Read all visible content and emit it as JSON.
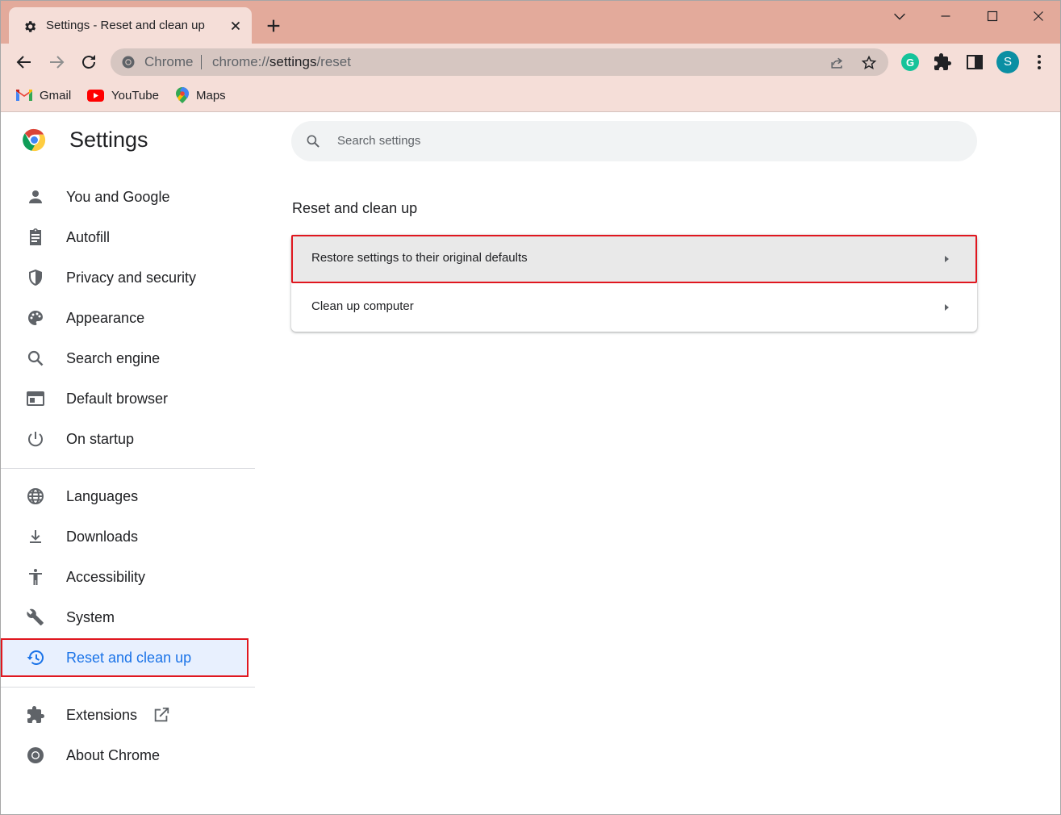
{
  "browser": {
    "tab_title": "Settings - Reset and clean up",
    "omnibox_site_label": "Chrome",
    "url_prefix": "chrome://",
    "url_host": "settings",
    "url_path": "/reset",
    "profile_initial": "S",
    "accent_colors": {
      "tabstrip": "#e3aa9b",
      "toolbar": "#f5ded8",
      "profile_avatar": "#0b8fa3",
      "highlight_border": "#e0171f",
      "active_blue": "#1a73e8"
    }
  },
  "bookmarks": [
    {
      "label": "Gmail",
      "icon": "gmail-icon"
    },
    {
      "label": "YouTube",
      "icon": "youtube-icon"
    },
    {
      "label": "Maps",
      "icon": "maps-icon"
    }
  ],
  "settings": {
    "title": "Settings",
    "search_placeholder": "Search settings",
    "nav_group_1": [
      {
        "label": "You and Google",
        "icon": "person-icon"
      },
      {
        "label": "Autofill",
        "icon": "clipboard-icon"
      },
      {
        "label": "Privacy and security",
        "icon": "shield-icon"
      },
      {
        "label": "Appearance",
        "icon": "palette-icon"
      },
      {
        "label": "Search engine",
        "icon": "search-icon"
      },
      {
        "label": "Default browser",
        "icon": "browser-icon"
      },
      {
        "label": "On startup",
        "icon": "power-icon"
      }
    ],
    "nav_group_2": [
      {
        "label": "Languages",
        "icon": "globe-icon"
      },
      {
        "label": "Downloads",
        "icon": "download-icon"
      },
      {
        "label": "Accessibility",
        "icon": "accessibility-icon"
      },
      {
        "label": "System",
        "icon": "wrench-icon"
      },
      {
        "label": "Reset and clean up",
        "icon": "restore-icon",
        "active": true
      }
    ],
    "nav_group_3": [
      {
        "label": "Extensions",
        "icon": "puzzle-icon"
      },
      {
        "label": "About Chrome",
        "icon": "chrome-icon"
      }
    ],
    "section_title": "Reset and clean up",
    "rows": [
      {
        "label": "Restore settings to their original defaults"
      },
      {
        "label": "Clean up computer"
      }
    ]
  }
}
